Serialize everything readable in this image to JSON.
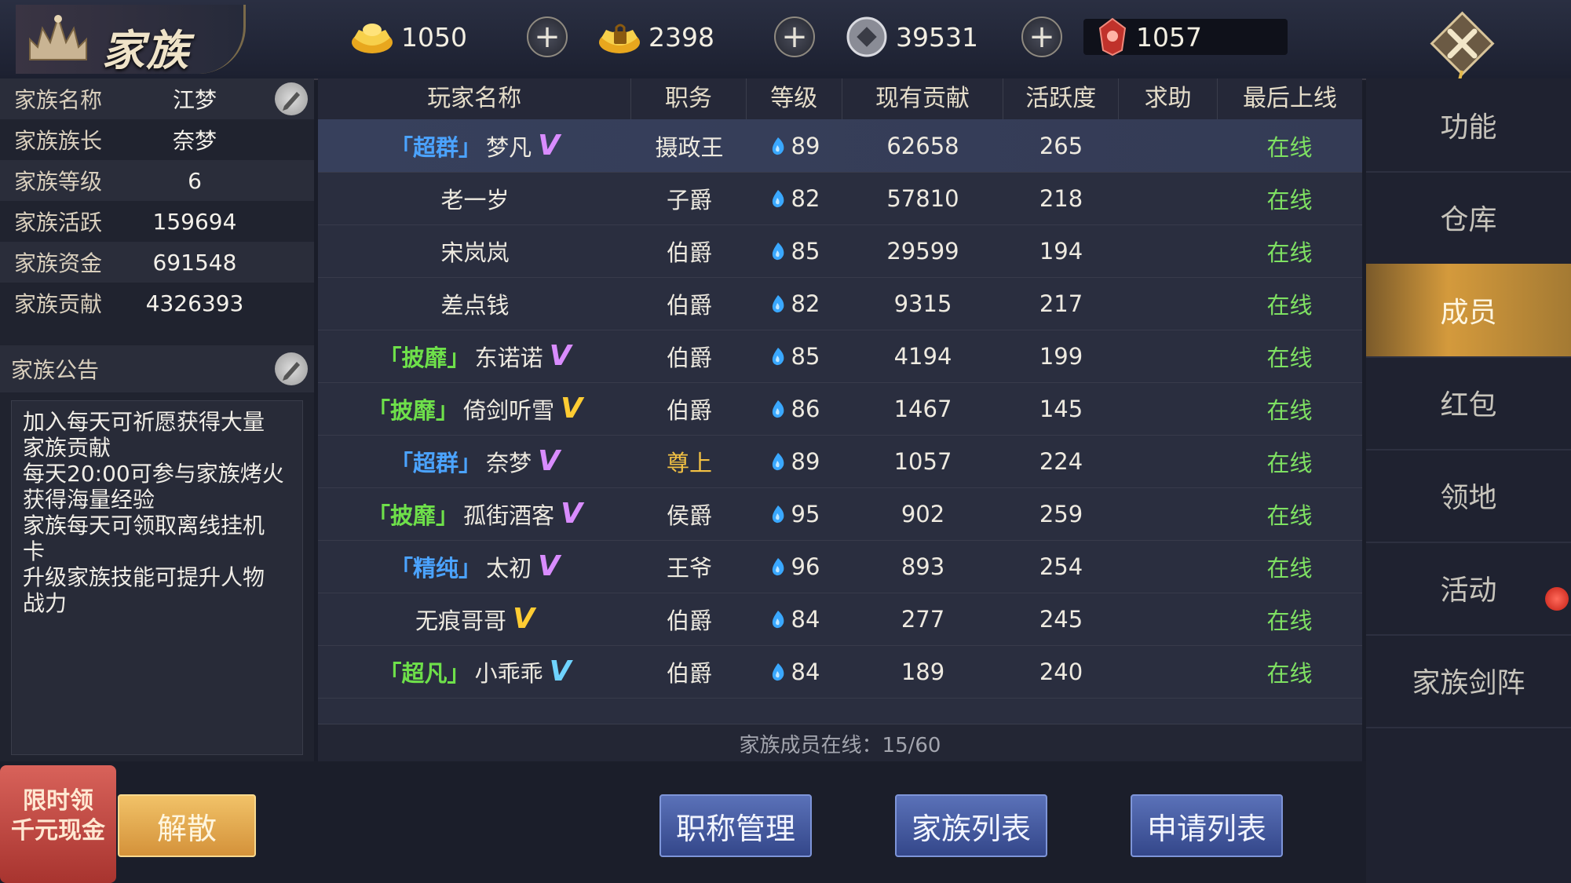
{
  "header": {
    "title": "家族",
    "currencies": [
      {
        "name": "gold-ingot",
        "value": "1050",
        "color": "#f7c531"
      },
      {
        "name": "locked-gold-ingot",
        "value": "2398",
        "color": "#f7c531"
      },
      {
        "name": "silver-coin",
        "value": "39531",
        "color": "#c9c9d0"
      },
      {
        "name": "red-gem",
        "value": "1057",
        "color": "#d03a32"
      }
    ]
  },
  "clan_info": {
    "rows": [
      {
        "label": "家族名称",
        "value": "江梦"
      },
      {
        "label": "家族族长",
        "value": "奈梦"
      },
      {
        "label": "家族等级",
        "value": "6"
      },
      {
        "label": "家族活跃",
        "value": "159694"
      },
      {
        "label": "家族资金",
        "value": "691548"
      },
      {
        "label": "家族贡献",
        "value": "4326393"
      }
    ],
    "notice_label": "家族公告",
    "notice_lines": [
      "加入每天可祈愿获得大量",
      "家族贡献",
      "每天20:00可参与家族烤火",
      "获得海量经验",
      "家族每天可领取离线挂机",
      "卡",
      "升级家族技能可提升人物",
      "战力"
    ]
  },
  "table": {
    "headers": [
      "玩家名称",
      "职务",
      "等级",
      "现有贡献",
      "活跃度",
      "求助",
      "最后上线"
    ],
    "rows": [
      {
        "tag": "「超群」",
        "tag_color": "blue",
        "name": "梦凡",
        "v": "V",
        "v_color": "pink",
        "job": "摄政王",
        "level": "89",
        "contrib": "62658",
        "active": "265",
        "help": "",
        "last": "在线"
      },
      {
        "tag": "",
        "tag_color": "",
        "name": "老一岁",
        "v": "",
        "v_color": "",
        "job": "子爵",
        "level": "82",
        "contrib": "57810",
        "active": "218",
        "help": "",
        "last": "在线"
      },
      {
        "tag": "",
        "tag_color": "",
        "name": "宋岚岚",
        "v": "",
        "v_color": "",
        "job": "伯爵",
        "level": "85",
        "contrib": "29599",
        "active": "194",
        "help": "",
        "last": "在线"
      },
      {
        "tag": "",
        "tag_color": "",
        "name": "差点钱",
        "v": "",
        "v_color": "",
        "job": "伯爵",
        "level": "82",
        "contrib": "9315",
        "active": "217",
        "help": "",
        "last": "在线"
      },
      {
        "tag": "「披靡」",
        "tag_color": "green",
        "name": "东诺诺",
        "v": "V",
        "v_color": "pink",
        "job": "伯爵",
        "level": "85",
        "contrib": "4194",
        "active": "199",
        "help": "",
        "last": "在线"
      },
      {
        "tag": "「披靡」",
        "tag_color": "green",
        "name": "倚剑听雪",
        "v": "V",
        "v_color": "gold",
        "job": "伯爵",
        "level": "86",
        "contrib": "1467",
        "active": "145",
        "help": "",
        "last": "在线"
      },
      {
        "tag": "「超群」",
        "tag_color": "blue",
        "name": "奈梦",
        "v": "V",
        "v_color": "pink",
        "job": "尊上",
        "level": "89",
        "contrib": "1057",
        "active": "224",
        "help": "",
        "last": "在线"
      },
      {
        "tag": "「披靡」",
        "tag_color": "green",
        "name": "孤街酒客",
        "v": "V",
        "v_color": "pink",
        "job": "侯爵",
        "level": "95",
        "contrib": "902",
        "active": "259",
        "help": "",
        "last": "在线"
      },
      {
        "tag": "「精纯」",
        "tag_color": "blue",
        "name": "太初",
        "v": "V",
        "v_color": "pink",
        "job": "王爷",
        "level": "96",
        "contrib": "893",
        "active": "254",
        "help": "",
        "last": "在线"
      },
      {
        "tag": "",
        "tag_color": "",
        "name": "无痕哥哥",
        "v": "V",
        "v_color": "gold",
        "job": "伯爵",
        "level": "84",
        "contrib": "277",
        "active": "245",
        "help": "",
        "last": "在线"
      },
      {
        "tag": "「超凡」",
        "tag_color": "green",
        "name": "小乖乖",
        "v": "V",
        "v_color": "cyan",
        "job": "伯爵",
        "level": "84",
        "contrib": "189",
        "active": "240",
        "help": "",
        "last": "在线"
      }
    ],
    "footer": "家族成员在线：15/60"
  },
  "menu": [
    "功能",
    "仓库",
    "成员",
    "红包",
    "领地",
    "活动",
    "家族剑阵"
  ],
  "active_menu": "成员",
  "buttons": {
    "disband": "解散",
    "title_manage": "职称管理",
    "clan_list": "家族列表",
    "apply_list": "申请列表"
  },
  "promo": {
    "line1": "限时领",
    "line2": "千元现金"
  },
  "colors": {
    "online": "#7ee062",
    "tag_blue": "#4ba3ff",
    "tag_green": "#6ee04a",
    "accent_gold": "#d49a3c"
  }
}
